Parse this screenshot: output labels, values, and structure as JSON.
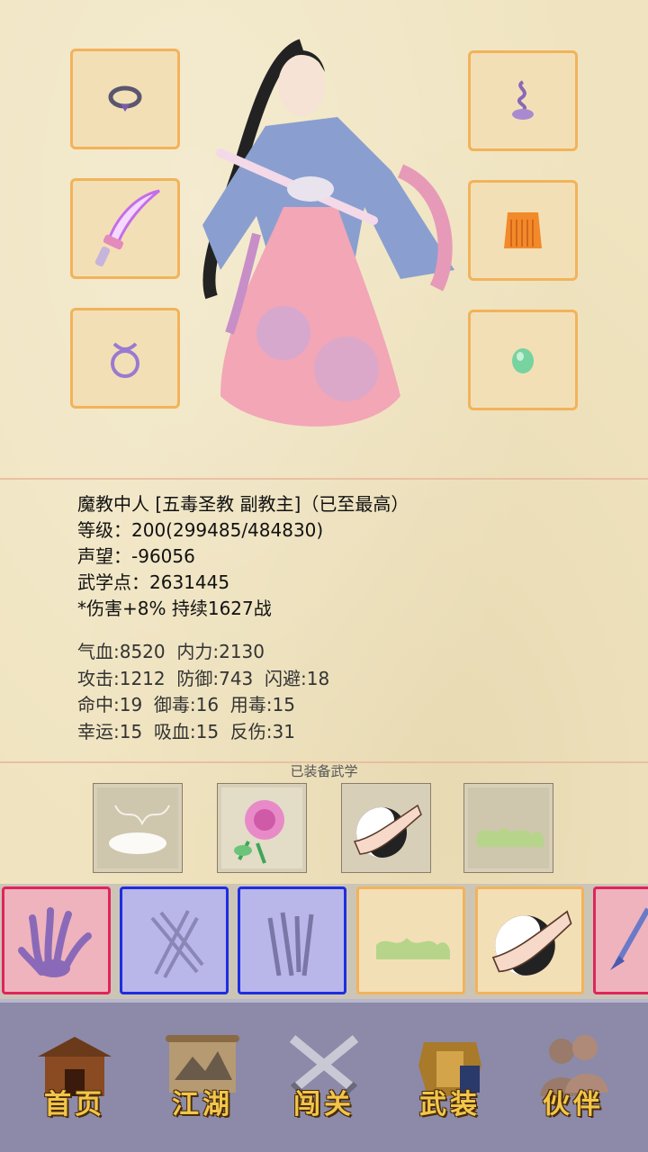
{
  "character": {
    "title_line": "魔教中人 [五毒圣教 副教主]（已至最高）",
    "level_line": "等级：200(299485/484830)",
    "reputation_line": "声望：-96056",
    "martial_points_line": "武学点：2631445",
    "buff_line": "*伤害+8% 持续1627战"
  },
  "stats": {
    "line1": "气血:8520  内力:2130",
    "line2": "攻击:1212  防御:743  闪避:18",
    "line3": "命中:19  御毒:16  用毒:15",
    "line4": "幸运:15  吸血:15  反伤:31"
  },
  "equipment_slots": [
    {
      "icon": "ring-icon"
    },
    {
      "icon": "saber-icon"
    },
    {
      "icon": "bracelet-icon"
    },
    {
      "icon": "hairpin-icon"
    },
    {
      "icon": "robe-icon"
    },
    {
      "icon": "jade-icon"
    }
  ],
  "equipped_skills_title": "已装备武学",
  "equipped_skills": [
    "mist-skill-icon",
    "rose-skill-icon",
    "taiji-fist-skill-icon",
    "grass-skill-icon"
  ],
  "skill_bar": [
    {
      "icon": "claw-skill-icon",
      "color": "red"
    },
    {
      "icon": "swords-skill-icon",
      "color": "blue"
    },
    {
      "icon": "blades-skill-icon",
      "color": "blue"
    },
    {
      "icon": "grass-skill-icon",
      "color": "orange"
    },
    {
      "icon": "taiji-fist-skill-icon",
      "color": "orange"
    },
    {
      "icon": "sword-skill-icon",
      "color": "red"
    }
  ],
  "nav": {
    "home": "首页",
    "jianghu": "江湖",
    "challenge": "闯关",
    "equipment": "武装",
    "companion": "伙伴"
  },
  "colors": {
    "slot_border": "#f2b35a",
    "red_border": "#e0245e",
    "blue_border": "#1e2ee0",
    "nav_bg": "#8c8aa8",
    "nav_text": "#f2c64a"
  }
}
